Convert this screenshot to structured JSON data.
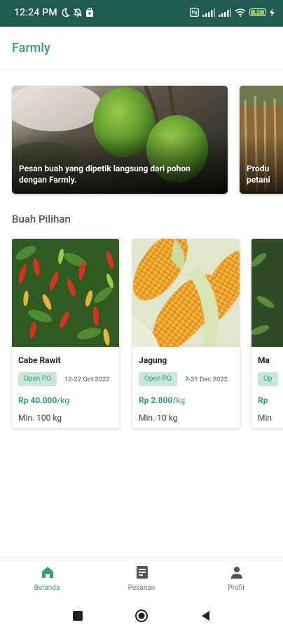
{
  "status_bar": {
    "time": "12:24 PM",
    "battery": "87"
  },
  "header": {
    "app_title": "Farmly"
  },
  "banners": [
    {
      "text": "Pesan buah yang dipetik langsung dari pohon\ndengan Farmly."
    },
    {
      "text": "Produ\npetani"
    }
  ],
  "section": {
    "title": "Buah Pilihan"
  },
  "products": [
    {
      "name": "Cabe Rawit",
      "badge": "Open PO",
      "date": "12-22 Oct 2022",
      "price": "Rp 40.000",
      "unit": "/kg",
      "min": "Min. 100 kg"
    },
    {
      "name": "Jagung",
      "badge": "Open PO",
      "date": "7-31 Dec 2022",
      "price": "Rp 2.800",
      "unit": "/kg",
      "min": "Min. 10 kg"
    },
    {
      "name": "Ma",
      "badge": "Op",
      "date": "",
      "price": "Rp",
      "unit": "",
      "min": "Min"
    }
  ],
  "bottom_nav": [
    {
      "label": "Beranda",
      "icon": "home-icon",
      "active": true
    },
    {
      "label": "Pesanan",
      "icon": "orders-icon",
      "active": false
    },
    {
      "label": "Profil",
      "icon": "profile-icon",
      "active": false
    }
  ],
  "colors": {
    "brand": "#2f9c8b",
    "status_bar": "#1f5b50",
    "badge_bg": "#c8e8d7"
  }
}
